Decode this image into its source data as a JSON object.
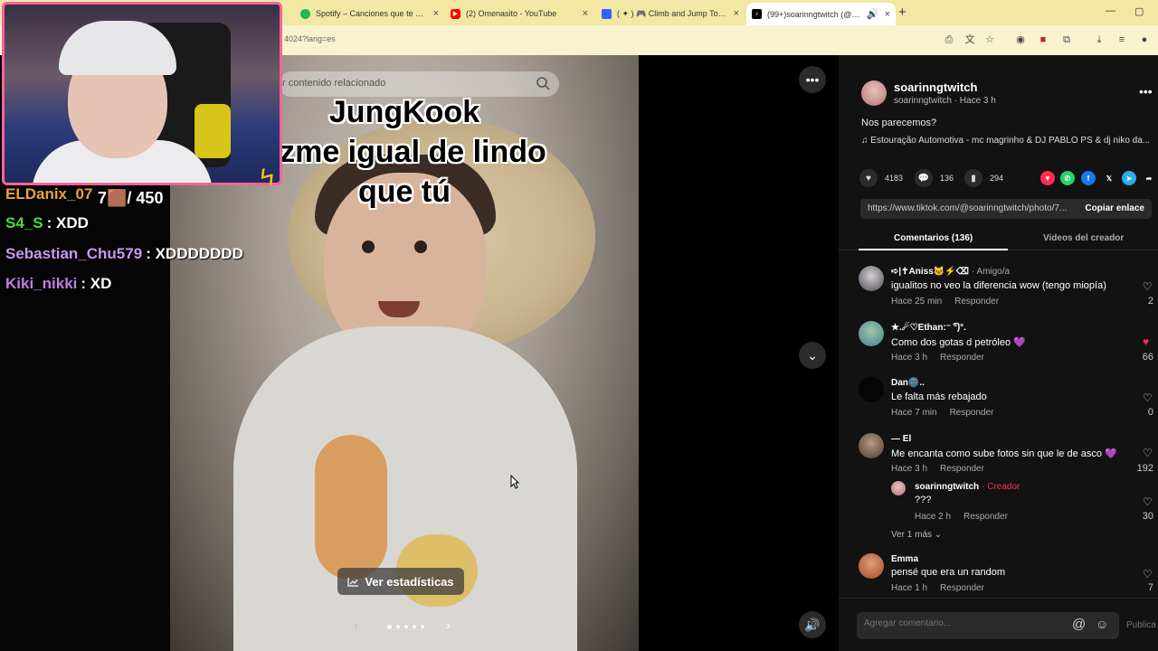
{
  "browser": {
    "tabs": [
      {
        "label": "Spotify – Canciones que te gust",
        "favicon": "spotify-icon",
        "color": "#1db954"
      },
      {
        "label": "(2) Omenasito - YouTube",
        "favicon": "youtube-icon",
        "color": "#ff0000"
      },
      {
        "label": "( ✦ ) 🎮 Climb and Jump Tower",
        "favicon": "roblox-icon",
        "color": "#335fff"
      },
      {
        "label": "(99+)soarinngtwitch (@soa",
        "favicon": "tiktok-icon",
        "color": "#000000"
      }
    ],
    "new_tab": "+",
    "url": "4024?lang=es"
  },
  "chat": {
    "messages": [
      {
        "user": "ELDanix_07",
        "text": "",
        "color": "#e8a33c"
      },
      {
        "user": "S4_S",
        "text": ": XDD",
        "color": "#4ddd3d"
      },
      {
        "user": "Sebastian_Chu579",
        "text": ": XDDDDDDD",
        "color": "#c69af0"
      },
      {
        "user": "Kiki_nikki",
        "text": ": XD",
        "color": "#c07de8"
      }
    ],
    "goal_counter": "7🟫/ 450"
  },
  "video": {
    "search_placeholder": "r contenido relacionado",
    "caption_lines": [
      "JungKook",
      "azme igual de lindo",
      "que tú"
    ],
    "stats_button": "Ver estadísticas",
    "slide_count": 5,
    "current_slide": 1
  },
  "post": {
    "author_name": "soarinngtwitch",
    "author_sub": "soarinngtwitch · Hace 3 h",
    "description": "Nos parecemos?",
    "music": "Estouração Automotiva - mc magrinho & DJ PABLO PS & dj niko da...",
    "likes": "4183",
    "comments": "136",
    "saves": "294",
    "link": "https://www.tiktok.com/@soarinngtwitch/photo/7...",
    "copy_link": "Copiar enlace",
    "tab_comments": "Comentarios (136)",
    "tab_videos": "Videos del creador"
  },
  "comments": [
    {
      "author": "➪|✝Aniss🐱⚡⌫",
      "tag": "· Amigo/a",
      "text": "igualitos no veo la diferencia wow (tengo miopía)",
      "time": "Hace 25 min",
      "reply": "Responder",
      "likes": "2",
      "liked": false
    },
    {
      "author": "★.☄♡Ethan:⁻ ͡°)°.",
      "tag": "",
      "text": "Como dos gotas d petróleo 💜",
      "time": "Hace 3 h",
      "reply": "Responder",
      "likes": "66",
      "liked": true
    },
    {
      "author": "Dan🌚..",
      "tag": "",
      "text": "Le falta más rebajado",
      "time": "Hace 7 min",
      "reply": "Responder",
      "likes": "0",
      "liked": false
    },
    {
      "author": "— El",
      "tag": "",
      "text": "Me encanta como sube fotos sin que le de asco 💜",
      "time": "Hace 3 h",
      "reply": "Responder",
      "likes": "192",
      "liked": false
    },
    {
      "author": "Emma",
      "tag": "",
      "text": "pensé que era un random",
      "time": "Hace 1 h",
      "reply": "Responder",
      "likes": "7",
      "liked": false
    }
  ],
  "reply": {
    "author": "soarinngtwitch",
    "creator_tag": "· Creador",
    "text": "???",
    "time": "Hace 2 h",
    "reply": "Responder",
    "likes": "30"
  },
  "more_replies": "Ver 1 más ⌄",
  "input": {
    "placeholder": "Agregar comentario...",
    "publish": "Publica"
  }
}
